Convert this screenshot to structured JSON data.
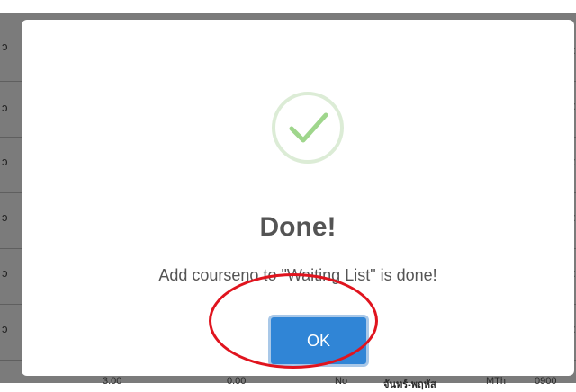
{
  "background": {
    "left_glyph": "ɔ",
    "right_glyph": ":",
    "bottom_cells": [
      "3.00",
      "0.00",
      "No",
      "จันทร์-พฤหัส",
      "MTh",
      "0900"
    ]
  },
  "dialog": {
    "icon": "success-check-icon",
    "title": "Done!",
    "message": "Add courseno to \"Waiting List\" is done!",
    "ok_label": "OK"
  },
  "colors": {
    "confirm_button": "#3085d6",
    "success_ring": "#dcecd6",
    "success_check": "#9fd68c",
    "annotation": "#e0141e"
  }
}
